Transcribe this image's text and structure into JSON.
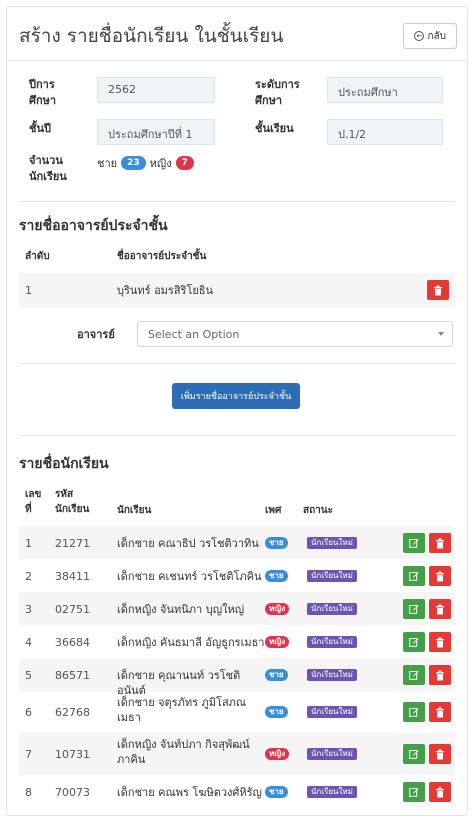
{
  "header": {
    "title": "สร้าง รายชื่อนักเรียน ในชั้นเรียน",
    "back_label": "กลับ"
  },
  "info": {
    "year_label": "ปีการศึกษา",
    "year_value": "2562",
    "level_label": "ระดับการศึกษา",
    "level_value": "ประถมศึกษา",
    "grade_label": "ชั้นปี",
    "grade_value": "ประถมศึกษาปีที่ 1",
    "class_label": "ชั้นเรียน",
    "class_value": "ป.1/2",
    "count_label": "จำนวนนักเรียน",
    "male_label": "ชาย",
    "male_count": "23",
    "female_label": "หญิง",
    "female_count": "7"
  },
  "teachers": {
    "section_title": "รายชื่ออาจารย์ประจำชั้น",
    "col_no": "ลำดับ",
    "col_name": "ชื่ออาจารย์ประจำชั้น",
    "rows": [
      {
        "no": "1",
        "name": "บุรินทร์ อมรสิริโยธิน"
      }
    ],
    "select_label": "อาจารย์",
    "select_placeholder": "Select an Option",
    "add_button": "เพิ่มรายชื่ออาจารย์ประจำชั้น"
  },
  "students": {
    "section_title": "รายชื่อนักเรียน",
    "col_no": "เลขที่",
    "col_code": "รหัสนักเรียน",
    "col_name": "นักเรียน",
    "col_gender": "เพศ",
    "col_status": "สถานะ",
    "rows": [
      {
        "no": "1",
        "code": "21271",
        "name1": "เด็กชาย คณาธิป วรโชติวาทิน",
        "name2": "",
        "gender": "ชาย",
        "status": "นักเรียนใหม่"
      },
      {
        "no": "2",
        "code": "38411",
        "name1": "เด็กชาย คเชนทร์ วรโชติโภคิน",
        "name2": "",
        "gender": "ชาย",
        "status": "นักเรียนใหม่"
      },
      {
        "no": "3",
        "code": "02751",
        "name1": "เด็กหญิง จันทนิภา บุญใหญ่",
        "name2": "",
        "gender": "หญิง",
        "status": "นักเรียนใหม่"
      },
      {
        "no": "4",
        "code": "36684",
        "name1": "เด็กหญิง คันธมาลี อัญธูกรเมธา",
        "name2": "",
        "gender": "หญิง",
        "status": "นักเรียนใหม่"
      },
      {
        "no": "5",
        "code": "86571",
        "name1": "เด็กชาย คุณานนท์ วรโชติอนันต์",
        "name2": "",
        "gender": "ชาย",
        "status": "นักเรียนใหม่"
      },
      {
        "no": "6",
        "code": "62768",
        "name1": "เด็กชาย จตุรภัทร ภูมิโสภณ",
        "name2": "เมธา",
        "gender": "ชาย",
        "status": "นักเรียนใหม่"
      },
      {
        "no": "7",
        "code": "10731",
        "name1": "เด็กหญิง จันท์ปภา กิจสุพัฒน์",
        "name2": "ภาคิน",
        "gender": "หญิง",
        "status": "นักเรียนใหม่"
      },
      {
        "no": "8",
        "code": "70073",
        "name1": "เด็กชาย คณพร โฆษิตวงศ์หิรัญ",
        "name2": "",
        "gender": "ชาย",
        "status": "นักเรียนใหม่"
      }
    ]
  },
  "colors": {
    "primary": "#2d6db5",
    "danger": "#e53935",
    "success": "#43a047",
    "male": "#3a8ed8",
    "female": "#e2334e",
    "status": "#6a56b0"
  }
}
